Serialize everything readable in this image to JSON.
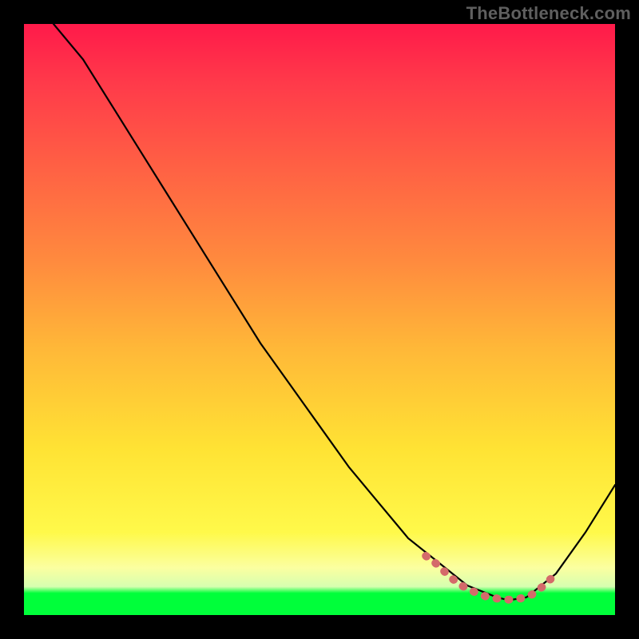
{
  "watermark": "TheBottleneck.com",
  "chart_data": {
    "type": "line",
    "title": "",
    "xlabel": "",
    "ylabel": "",
    "xlim": [
      0,
      100
    ],
    "ylim": [
      0,
      100
    ],
    "series": [
      {
        "name": "main-curve",
        "color": "#000000",
        "x": [
          5,
          10,
          15,
          20,
          25,
          30,
          35,
          40,
          45,
          50,
          55,
          60,
          65,
          70,
          75,
          80,
          82,
          85,
          90,
          95,
          100
        ],
        "y": [
          100,
          94,
          86,
          78,
          70,
          62,
          54,
          46,
          39,
          32,
          25,
          19,
          13,
          9,
          5,
          3,
          2.5,
          3,
          7,
          14,
          22
        ]
      },
      {
        "name": "bottleneck-marker",
        "color": "#d46a6a",
        "x": [
          68,
          70,
          72,
          74,
          76,
          78,
          80,
          82,
          84,
          86,
          88,
          90
        ],
        "y": [
          10,
          8.5,
          6.5,
          5,
          4,
          3.2,
          2.8,
          2.6,
          2.8,
          3.5,
          5,
          7
        ]
      }
    ],
    "gradient_stops": [
      {
        "pct": 0,
        "color": "#ff1a4a"
      },
      {
        "pct": 10,
        "color": "#ff3a4a"
      },
      {
        "pct": 24,
        "color": "#ff6044"
      },
      {
        "pct": 40,
        "color": "#ff8a3e"
      },
      {
        "pct": 55,
        "color": "#ffb838"
      },
      {
        "pct": 72,
        "color": "#ffe334"
      },
      {
        "pct": 86,
        "color": "#fff94a"
      },
      {
        "pct": 92,
        "color": "#fbffa0"
      },
      {
        "pct": 95.2,
        "color": "#d6ffb0"
      },
      {
        "pct": 96.3,
        "color": "#00ff3a"
      },
      {
        "pct": 100,
        "color": "#00ff3a"
      }
    ]
  }
}
